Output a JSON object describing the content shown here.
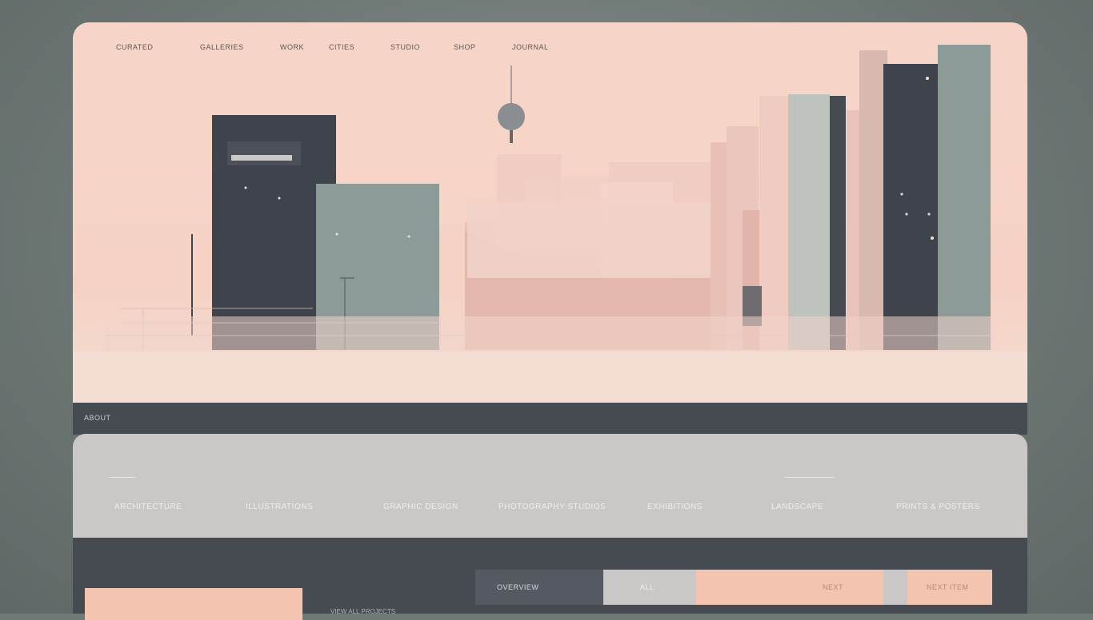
{
  "nav": {
    "items": [
      {
        "label": "CURATED"
      },
      {
        "label": "GALLERIES"
      },
      {
        "label": "WORK"
      },
      {
        "label": "CITIES"
      },
      {
        "label": "STUDIO"
      },
      {
        "label": "SHOP"
      },
      {
        "label": "JOURNAL"
      }
    ]
  },
  "band": {
    "label": "ABOUT"
  },
  "menu": {
    "items": [
      {
        "label": "ARCHITECTURE"
      },
      {
        "label": "ILLUSTRATIONS"
      },
      {
        "label": "GRAPHIC DESIGN"
      },
      {
        "label": "PHOTOGRAPHY STUDIOS"
      },
      {
        "label": "EXHIBITIONS"
      },
      {
        "label": "LANDSCAPE"
      },
      {
        "label": "PRINTS & POSTERS"
      }
    ]
  },
  "lower": {
    "small_text": "VIEW ALL PROJECTS",
    "tabs": [
      {
        "label": "OVERVIEW"
      },
      {
        "label": "ALL"
      },
      {
        "label": ""
      },
      {
        "label": "NEXT"
      },
      {
        "label": ""
      },
      {
        "label": "NEXT ITEM"
      }
    ]
  },
  "colors": {
    "peach": "#f5d2c4",
    "slate": "#464a51",
    "sage": "#8d9b98",
    "light_gray": "#c9c8c6",
    "salmon": "#f3c5b1"
  }
}
